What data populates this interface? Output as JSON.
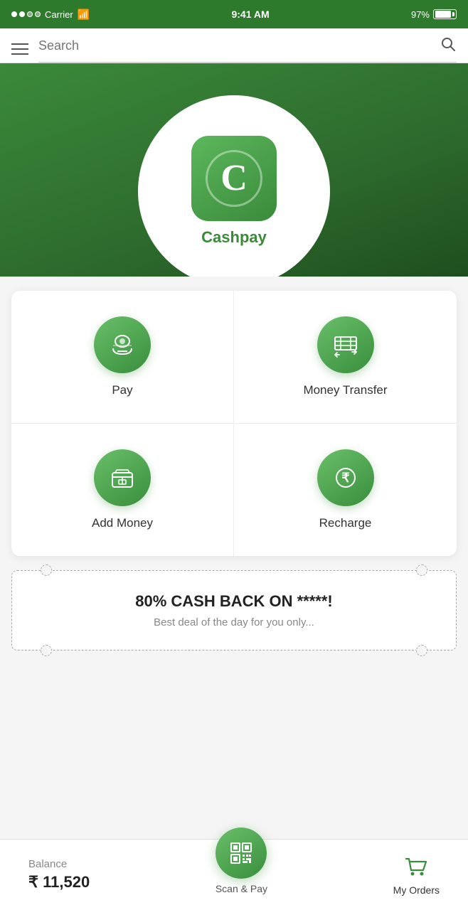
{
  "statusBar": {
    "carrier": "Carrier",
    "time": "9:41 AM",
    "signal": "97%"
  },
  "header": {
    "searchPlaceholder": "Search"
  },
  "hero": {
    "appName": "Cashpay",
    "logoLetter": "C"
  },
  "actions": [
    {
      "id": "pay",
      "label": "Pay",
      "icon": "💵"
    },
    {
      "id": "money-transfer",
      "label": "Money Transfer",
      "icon": "🏦"
    },
    {
      "id": "add-money",
      "label": "Add Money",
      "icon": "👜"
    },
    {
      "id": "recharge",
      "label": "Recharge",
      "icon": "₹"
    }
  ],
  "promo": {
    "title": "80% CASH BACK ON *****!",
    "subtitle": "Best deal of the day for you only..."
  },
  "bottomBar": {
    "balanceLabel": "Balance",
    "balanceAmount": "₹ 11,520",
    "scanLabel": "Scan & Pay",
    "ordersLabel": "My Orders"
  }
}
